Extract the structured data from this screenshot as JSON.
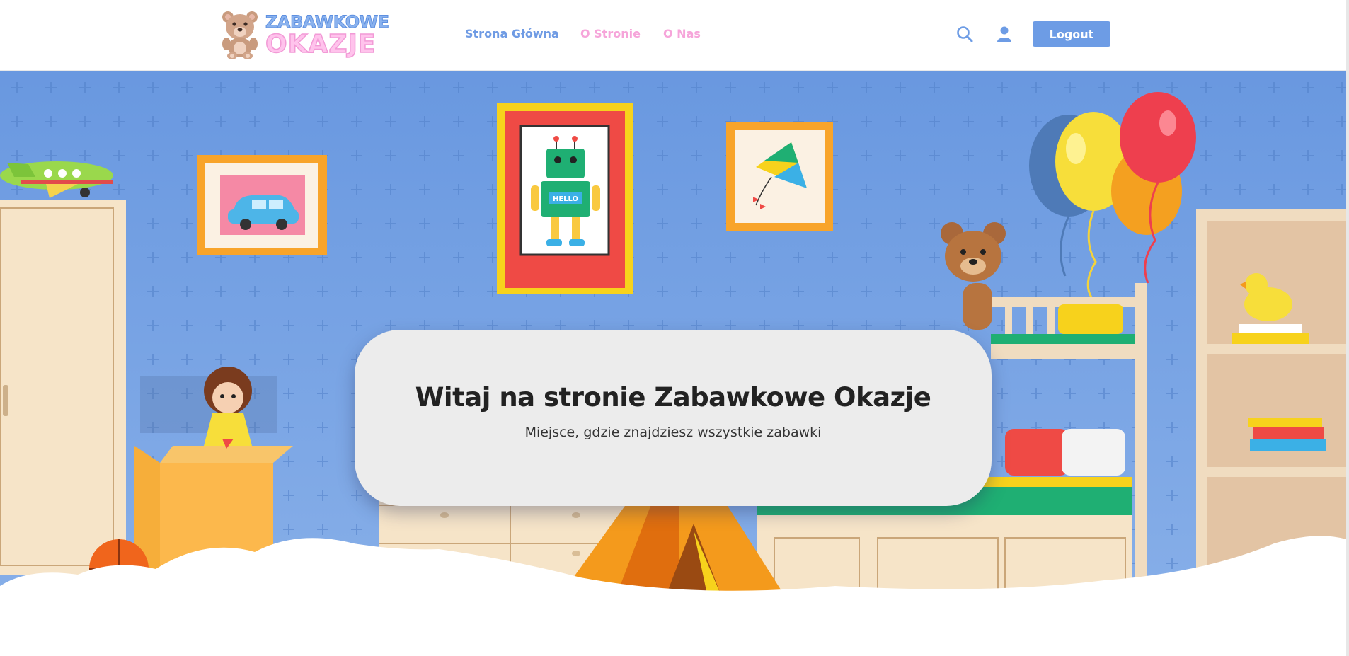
{
  "header": {
    "logo": {
      "line1": "ZABAWKOWE",
      "line2": "OKAZJE"
    },
    "nav": [
      {
        "label": "Strona Główna",
        "color": "#6f9be4"
      },
      {
        "label": "O Stronie",
        "color": "#f6a5da"
      },
      {
        "label": "O Nas",
        "color": "#f6a5da"
      }
    ],
    "icons": [
      "search-icon",
      "user-icon"
    ],
    "logout_label": "Logout",
    "accent_color": "#6d9ce5"
  },
  "hero": {
    "title": "Witaj na stronie Zabawkowe Okazje",
    "subtitle": "Miejsce, gdzie znajdziesz wszystkie zabawki",
    "robot_badge": "HELLO",
    "wall_color": "#6b9be0"
  }
}
